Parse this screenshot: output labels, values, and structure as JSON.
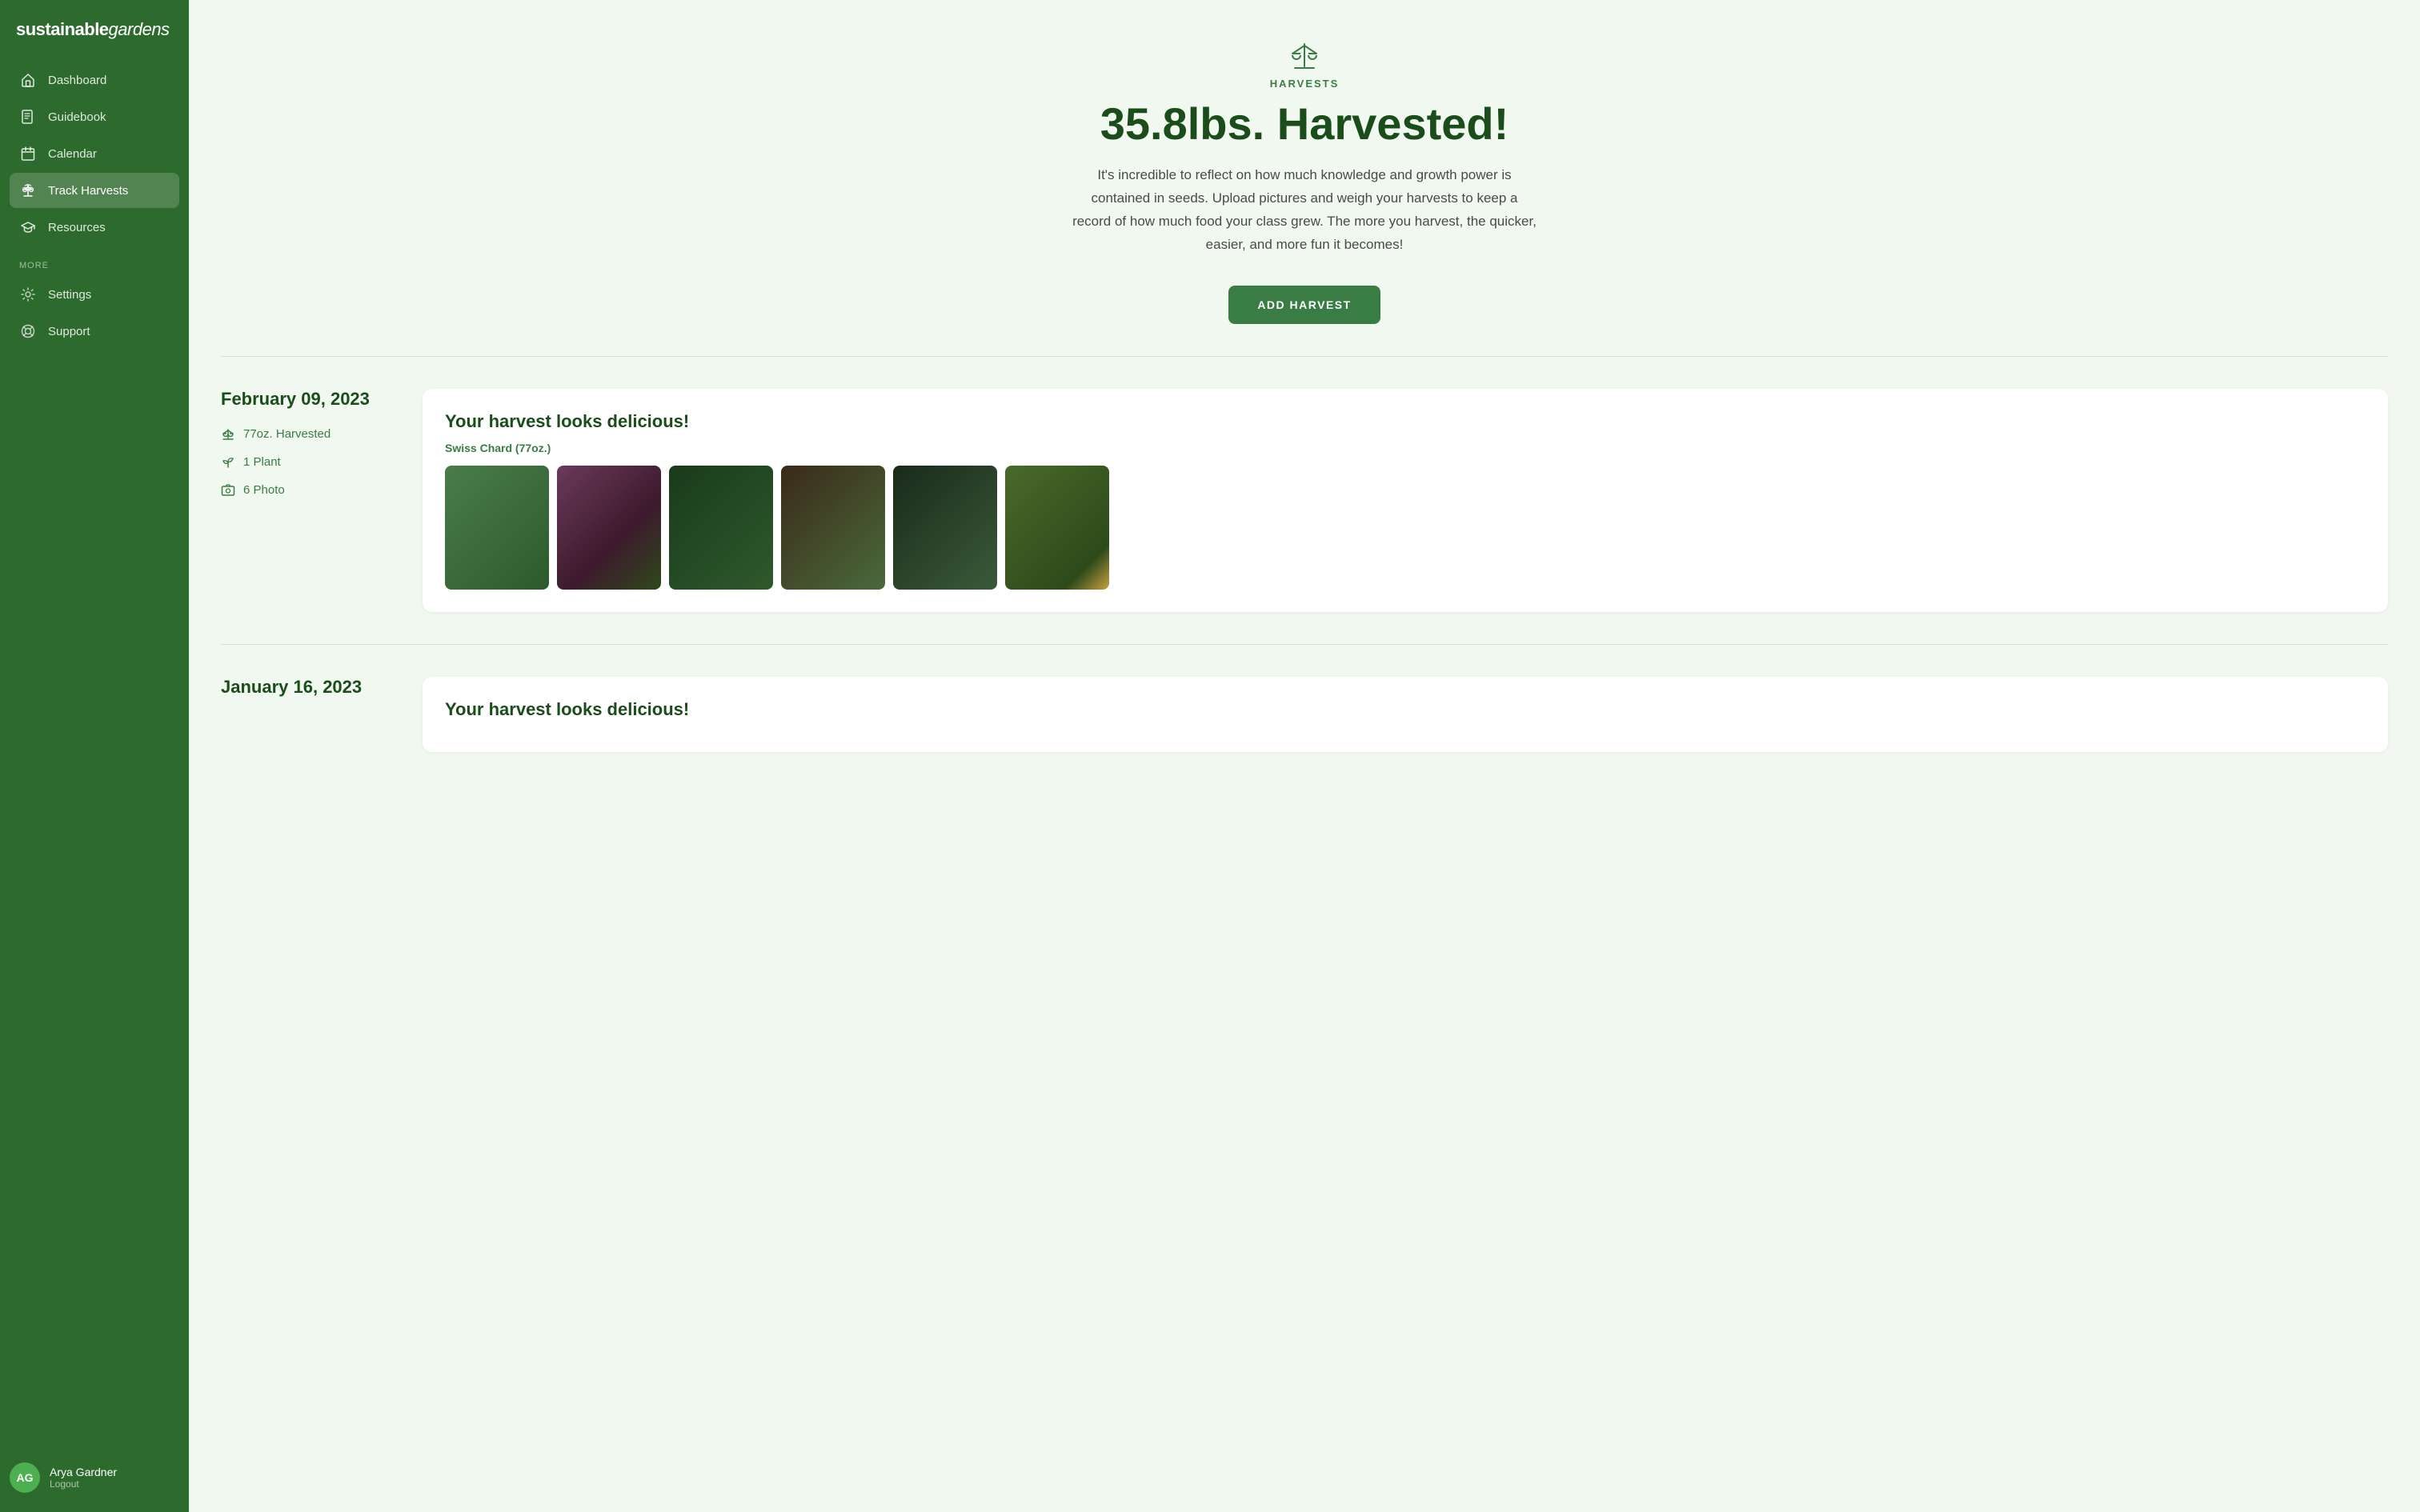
{
  "app": {
    "logo_bold": "sustainable",
    "logo_italic": "gardens"
  },
  "sidebar": {
    "nav_items": [
      {
        "id": "dashboard",
        "label": "Dashboard",
        "icon": "home"
      },
      {
        "id": "guidebook",
        "label": "Guidebook",
        "icon": "book"
      },
      {
        "id": "calendar",
        "label": "Calendar",
        "icon": "calendar"
      },
      {
        "id": "track-harvests",
        "label": "Track Harvests",
        "icon": "scale",
        "active": true
      },
      {
        "id": "resources",
        "label": "Resources",
        "icon": "mortarboard"
      }
    ],
    "more_label": "MORE",
    "more_items": [
      {
        "id": "settings",
        "label": "Settings",
        "icon": "gear"
      },
      {
        "id": "support",
        "label": "Support",
        "icon": "lifering"
      }
    ],
    "user": {
      "initials": "AG",
      "name": "Arya Gardner",
      "logout_label": "Logout"
    }
  },
  "hero": {
    "icon_label": "scale",
    "section_label": "HARVESTS",
    "title": "35.8lbs. Harvested!",
    "description": "It's incredible to reflect on how much knowledge and growth power is contained in seeds. Upload pictures and weigh your harvests to keep a record of how much food your class grew. The more you harvest, the quicker, easier, and more fun it becomes!",
    "add_button": "ADD HARVEST"
  },
  "entries": [
    {
      "date": "February 09, 2023",
      "weight": "77oz. Harvested",
      "plants": "1 Plant",
      "photos": "6 Photo",
      "card_title": "Your harvest looks delicious!",
      "plant_tag": "Swiss Chard (77oz.)",
      "photo_count": 6
    },
    {
      "date": "January 16, 2023",
      "weight": "",
      "plants": "",
      "photos": "",
      "card_title": "Your harvest looks delicious!",
      "plant_tag": "",
      "photo_count": 0
    }
  ]
}
